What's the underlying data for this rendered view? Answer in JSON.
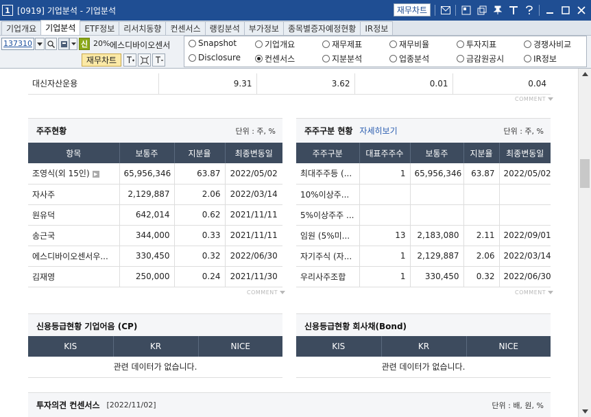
{
  "window": {
    "number": "1",
    "title": "[0919] 기업분석 - 기업분석",
    "fin_chart_btn": "재무차트"
  },
  "tabs": [
    "기업개요",
    "기업분석",
    "ETF정보",
    "리서치동향",
    "컨센서스",
    "랭킹분석",
    "부가정보",
    "종목별증자예정현황",
    "IR정보"
  ],
  "toolbar": {
    "code": "137310",
    "new_badge": "신",
    "percent": "20%",
    "stock_name": "에스디바이오센서",
    "fin_chart": "재무차트"
  },
  "radios": [
    {
      "label": "Snapshot",
      "checked": false
    },
    {
      "label": "기업개요",
      "checked": false
    },
    {
      "label": "재무제표",
      "checked": false
    },
    {
      "label": "재무비율",
      "checked": false
    },
    {
      "label": "투자지표",
      "checked": false
    },
    {
      "label": "경쟁사비교",
      "checked": false
    },
    {
      "label": "Disclosure",
      "checked": false
    },
    {
      "label": "컨센서스",
      "checked": true
    },
    {
      "label": "지분분석",
      "checked": false
    },
    {
      "label": "업종분석",
      "checked": false
    },
    {
      "label": "금감원공시",
      "checked": false
    },
    {
      "label": "IR정보",
      "checked": false
    }
  ],
  "top_row": {
    "name": "대신자산운용",
    "v1": "9.31",
    "v2": "3.62",
    "v3": "0.01",
    "v4": "0.04"
  },
  "comment_label": "COMMENT",
  "shareholders": {
    "title": "주주현황",
    "unit": "단위 : 주, %",
    "headers": [
      "항목",
      "보통주",
      "지분율",
      "최종변동일"
    ],
    "rows": [
      {
        "name": "조영식(외 15인)",
        "shares": "65,956,346",
        "pct": "63.87",
        "date": "2022/05/02"
      },
      {
        "name": "자사주",
        "shares": "2,129,887",
        "pct": "2.06",
        "date": "2022/03/14"
      },
      {
        "name": "원유덕",
        "shares": "642,014",
        "pct": "0.62",
        "date": "2021/11/11"
      },
      {
        "name": "송근국",
        "shares": "344,000",
        "pct": "0.33",
        "date": "2021/11/11"
      },
      {
        "name": "에스디바이오센서우...",
        "shares": "330,450",
        "pct": "0.32",
        "date": "2022/06/30"
      },
      {
        "name": "김재영",
        "shares": "250,000",
        "pct": "0.24",
        "date": "2021/11/30"
      }
    ]
  },
  "holder_types": {
    "title": "주주구분 현황",
    "link": "자세히보기",
    "unit": "단위 : 주, %",
    "headers": [
      "주주구분",
      "대표주주수",
      "보통주",
      "지분율",
      "최종변동일"
    ],
    "rows": [
      {
        "type": "최대주주등 (...",
        "count": "1",
        "shares": "65,956,346",
        "pct": "63.87",
        "date": "2022/05/02"
      },
      {
        "type": "10%이상주...",
        "count": "",
        "shares": "",
        "pct": "",
        "date": ""
      },
      {
        "type": "5%이상주주 ...",
        "count": "",
        "shares": "",
        "pct": "",
        "date": ""
      },
      {
        "type": "임원 (5%미...",
        "count": "13",
        "shares": "2,183,080",
        "pct": "2.11",
        "date": "2022/09/01"
      },
      {
        "type": "자기주식 (자...",
        "count": "1",
        "shares": "2,129,887",
        "pct": "2.06",
        "date": "2022/03/14"
      },
      {
        "type": "우리사주조합",
        "count": "1",
        "shares": "330,450",
        "pct": "0.32",
        "date": "2022/06/30"
      }
    ]
  },
  "credit_cp": {
    "title": "신용등급현황 기업어음 (CP)",
    "headers": [
      "KIS",
      "KR",
      "NICE"
    ],
    "nodata": "관련 데이터가 없습니다."
  },
  "credit_bond": {
    "title": "신용등급현황 회사채(Bond)",
    "headers": [
      "KIS",
      "KR",
      "NICE"
    ],
    "nodata": "관련 데이터가 없습니다."
  },
  "consensus": {
    "title": "투자의견 컨센서스",
    "date": "[2022/11/02]",
    "unit": "단위 : 배, 원, %"
  }
}
